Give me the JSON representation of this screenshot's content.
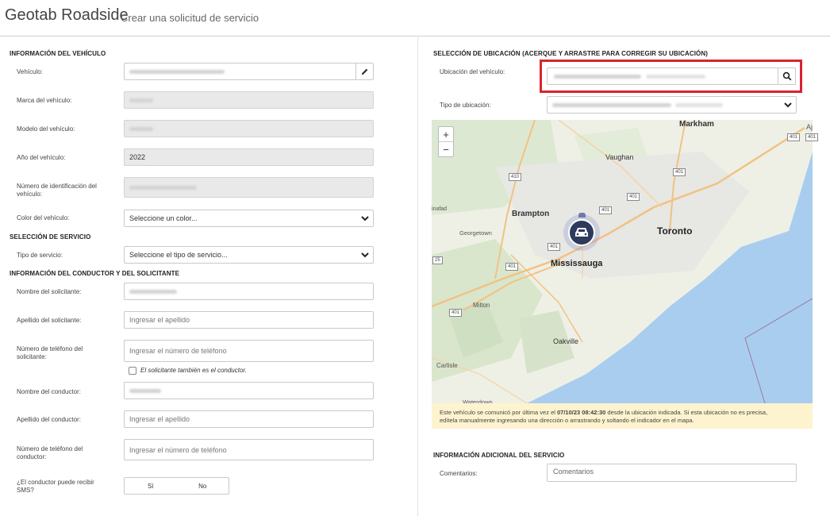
{
  "header": {
    "app_title": "Geotab Roadside",
    "page_title": "Crear una solicitud de servicio"
  },
  "vehicle": {
    "section": "INFORMACIÓN DEL VEHÍCULO",
    "vehicle_label": "Vehículo:",
    "make_label": "Marca del vehículo:",
    "model_label": "Modelo del vehículo:",
    "year_label": "Año del vehículo:",
    "year_value": "2022",
    "vin_label_1": "Número de identificación del",
    "vin_label_2": "vehículo:",
    "color_label": "Color del vehículo:",
    "color_value": "Seleccione un color..."
  },
  "service": {
    "section": "SELECCIÓN DE SERVICIO",
    "type_label": "Tipo de servicio:",
    "type_value": "Seleccione el tipo de servicio..."
  },
  "driver": {
    "section": "INFORMACIÓN DEL CONDUCTOR Y DEL SOLICITANTE",
    "requester_name_label": "Nombre del solicitante:",
    "requester_last_label": "Apellido del solicitante:",
    "requester_last_ph": "Ingresar el apellido",
    "requester_phone_label_1": "Número de teléfono del",
    "requester_phone_label_2": "solicitante:",
    "requester_phone_ph": "Ingresar el número de teléfono",
    "same_checkbox": "El solicitante también es el conductor.",
    "driver_name_label": "Nombre del conductor:",
    "driver_last_label": "Apellido del conductor:",
    "driver_last_ph": "Ingresar el apellido",
    "driver_phone_label_1": "Número de teléfono del",
    "driver_phone_label_2": "conductor:",
    "driver_phone_ph": "Ingresar el número de teléfono",
    "sms_label_1": "¿El conductor puede recibir",
    "sms_label_2": "SMS?",
    "sms_yes": "Sí",
    "sms_no": "No"
  },
  "location": {
    "section": "SELECCIÓN DE UBICACIÓN (ACERQUE Y ARRASTRE PARA CORREGIR SU UBICACIÓN)",
    "vehicle_location_label": "Ubicación del vehículo:",
    "type_label": "Tipo de ubicación:"
  },
  "map": {
    "zoom_in": "+",
    "zoom_out": "−",
    "cities": [
      "Markham",
      "Vaughan",
      "Brampton",
      "Toronto",
      "Georgetown",
      "Mississauga",
      "Milton",
      "Oakville",
      "Carlisle",
      "Waterdown",
      "inafad",
      "Aj"
    ],
    "shields": [
      "401",
      "410",
      "401",
      "401",
      "401",
      "401",
      "25",
      "401",
      "401",
      "401"
    ]
  },
  "notice": {
    "pre": "Este vehículo se comunicó por última vez el ",
    "timestamp": "07/10/23 08:42:30",
    "post": " desde la ubicación indicada. Si esta ubicación no es precisa,",
    "line2": "edítela manualmente ingresando una dirección o arrastrando y soltando el indicador en el mapa."
  },
  "additional": {
    "section": "INFORMACIÓN ADICIONAL DEL SERVICIO",
    "comments_label": "Comentarios:",
    "comments_ph": "Comentarios"
  },
  "colors": {
    "highlight": "#d9232d",
    "water": "#a9cdef",
    "marker": "#2d3a5c",
    "notice_bg": "#fdf4cf"
  }
}
